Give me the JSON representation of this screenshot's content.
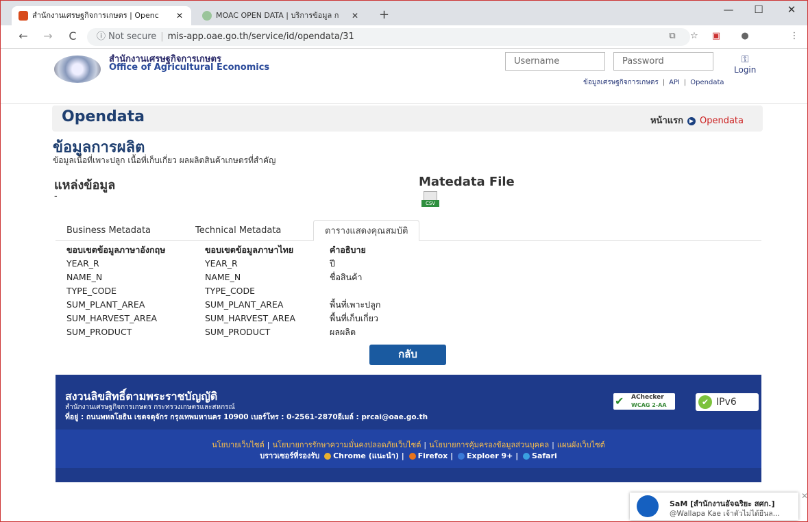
{
  "browser": {
    "tabs": [
      {
        "title": "สำนักงานเศรษฐกิจการเกษตร | Openc",
        "active": true
      },
      {
        "title": "MOAC OPEN DATA | บริการข้อมูล ก",
        "active": false
      }
    ],
    "new_tab": "+",
    "window_controls": {
      "minimize": "—",
      "maximize": "☐",
      "close": "✕"
    },
    "nav": {
      "back": "←",
      "forward": "→",
      "reload": "C"
    },
    "address": {
      "security": "ⓘ Not secure",
      "url": "mis-app.oae.go.th/service/id/opendata/31"
    }
  },
  "site": {
    "org_thai": "สำนักงานเศรษฐกิจการเกษตร",
    "org_english": "Office of Agricultural Economics",
    "username_placeholder": "Username",
    "password_placeholder": "Password",
    "login_label": "Login",
    "top_links": [
      "ข้อมูลเศรษฐกิจการเกษตร",
      "API",
      "Opendata"
    ]
  },
  "page": {
    "title": "Opendata",
    "breadcrumb_home": "หน้าแรก",
    "breadcrumb_current": "Opendata",
    "section_title": "ข้อมูลการผลิต",
    "section_desc": "ข้อมูลเนื้อที่เพาะปลูก เนื้อที่เก็บเกี่ยว ผลผลิตสินค้าเกษตรที่สำคัญ",
    "source_label": "แหล่งข้อมูล",
    "source_value": "-",
    "metadata_label": "Matedata File",
    "csv_label": "CSV",
    "tabs": [
      "Business Metadata",
      "Technical Metadata",
      "ตารางแสดงคุณสมบัติ"
    ],
    "table": {
      "headers": [
        "ขอบเขตข้อมูลภาษาอังกฤษ",
        "ขอบเขตข้อมูลภาษาไทย",
        "คำอธิบาย"
      ],
      "rows": [
        [
          "YEAR_R",
          "YEAR_R",
          "ปี"
        ],
        [
          "NAME_N",
          "NAME_N",
          "ชื่อสินค้า"
        ],
        [
          "TYPE_CODE",
          "TYPE_CODE",
          ""
        ],
        [
          "SUM_PLANT_AREA",
          "SUM_PLANT_AREA",
          "พื้นที่เพาะปลูก"
        ],
        [
          "SUM_HARVEST_AREA",
          "SUM_HARVEST_AREA",
          "พื้นที่เก็บเกี่ยว"
        ],
        [
          "SUM_PRODUCT",
          "SUM_PRODUCT",
          "ผลผลิต"
        ]
      ]
    },
    "back_button": "กลับ"
  },
  "footer": {
    "title": "สงวนลิขสิทธิ์ตามพระราชบัญญัติ",
    "org": "สำนักงานเศรษฐกิจการเกษตร กระทรวงเกษตรและสหกรณ์",
    "address": "ที่อยู่ : ถนนพหลโยธิน เขตจตุจักร กรุงเทพมหานคร 10900 เบอร์โทร : 0-2561-2870อีเมล์ : prcai@oae.go.th",
    "achecker": "AChecker",
    "achecker_sub": "WCAG 2-AA",
    "ipv6": "IPv6",
    "links": [
      "นโยบายเว็บไซต์",
      "นโยบายการรักษาความมั่นคงปลอดภัยเว็บไซต์",
      "นโยบายการคุ้มครองข้อมูลส่วนบุคคล",
      "แผนผังเว็บไซต์"
    ],
    "browsers_label": "บราวเซอร์ที่รองรับ",
    "browsers": [
      "Chrome (แนะนำ)",
      "Firefox",
      "Exploer 9+",
      "Safari"
    ]
  },
  "notification": {
    "name": "SaM [สำนักงานอัจฉริยะ สศก.]",
    "message": "@Wallapa Kae เจ้าตัวไม่ได้ยืนล..."
  }
}
